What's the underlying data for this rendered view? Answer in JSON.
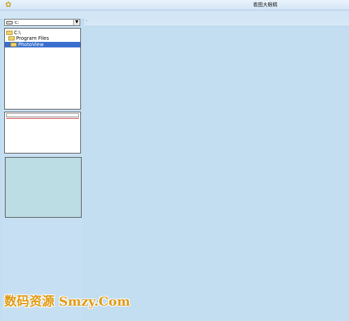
{
  "window": {
    "title": "看图大眼睛"
  },
  "drive_select": {
    "value": "c:"
  },
  "tree": {
    "items": [
      {
        "label": "C:\\"
      },
      {
        "label": "Program Files"
      },
      {
        "label": "PhotoView",
        "selected": true
      }
    ]
  },
  "watermark": {
    "text": "数码资源 Smzy.Com"
  }
}
